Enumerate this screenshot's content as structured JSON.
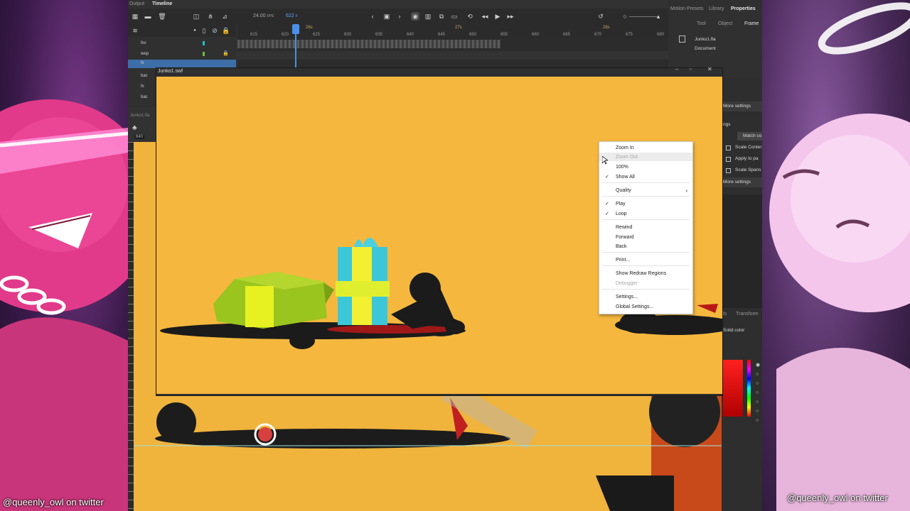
{
  "app": {
    "top_tabs": [
      "Output",
      "Timeline"
    ],
    "right_panel_tabs": [
      "Motion Presets",
      "Library",
      "Properties"
    ],
    "sub_tabs": [
      "Tool",
      "Object",
      "Frame"
    ],
    "document_file": "Junko1.fla",
    "document_type": "Document"
  },
  "timeline": {
    "fps": "24.00",
    "fps_unit": "FPS",
    "current_frame": "622",
    "frame_unit": "F",
    "marker_1": "26s",
    "marker_2": "27s",
    "marker_3": "28s",
    "ruler": [
      "615",
      "620",
      "625",
      "630",
      "635",
      "640",
      "645",
      "650",
      "655",
      "660",
      "665",
      "670",
      "675",
      "680"
    ],
    "layers": [
      "fxv",
      "wep",
      "fx",
      "bac",
      "fx",
      "bac"
    ]
  },
  "library_stub": {
    "label": "Junko1.fla",
    "ruler_value": "640"
  },
  "swf_window": {
    "title": "Junko1.swf"
  },
  "context_menu": {
    "items": [
      {
        "label": "Zoom In",
        "enabled": true,
        "checked": false
      },
      {
        "label": "Zoom Out",
        "enabled": false,
        "checked": false
      },
      {
        "label": "100%",
        "enabled": true,
        "checked": false
      },
      {
        "label": "Show All",
        "enabled": true,
        "checked": true
      },
      {
        "label": "Quality",
        "enabled": true,
        "checked": false,
        "submenu": true
      },
      {
        "label": "Play",
        "enabled": true,
        "checked": true
      },
      {
        "label": "Loop",
        "enabled": true,
        "checked": true
      },
      {
        "label": "Rewind",
        "enabled": true,
        "checked": false
      },
      {
        "label": "Forward",
        "enabled": true,
        "checked": false
      },
      {
        "label": "Back",
        "enabled": true,
        "checked": false
      },
      {
        "label": "Print...",
        "enabled": true,
        "checked": false
      },
      {
        "label": "Show Redraw Regions",
        "enabled": true,
        "checked": false
      },
      {
        "label": "Debugger",
        "enabled": false,
        "checked": false
      },
      {
        "label": "Settings...",
        "enabled": true,
        "checked": false
      },
      {
        "label": "Global Settings...",
        "enabled": true,
        "checked": false
      }
    ]
  },
  "properties": {
    "more_settings_1": "More settings",
    "section_label": "ngs",
    "match_button": "Match co",
    "scale_content": "Scale Conter",
    "apply_to": "Apply to pa",
    "scale_spans": "Scale Spans",
    "more_settings_2": "More settings",
    "bottom_tab_1": "ls",
    "bottom_tab_2": "Transform",
    "fill_mode": "Solid color"
  },
  "credits": {
    "left": "@queenly_owl on twitter",
    "right": "@queenly_owl on twitter"
  },
  "colors": {
    "stage": "#f5b73e",
    "panel": "#323232",
    "accent_blue": "#3d8fe0",
    "playhead": "#4a8fe8"
  }
}
